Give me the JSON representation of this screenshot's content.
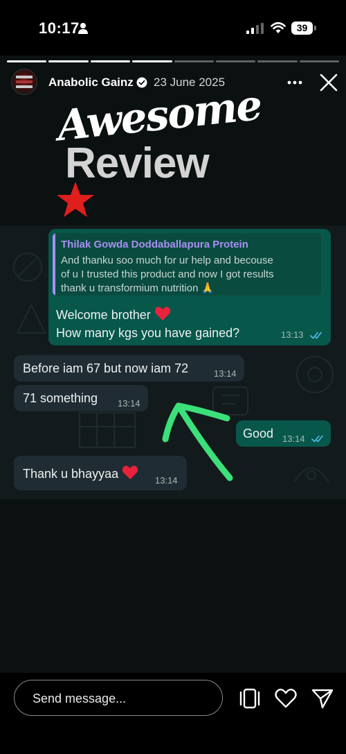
{
  "status_bar": {
    "time": "10:17",
    "battery": "39"
  },
  "story": {
    "username": "Anabolic Gainz",
    "date": "23 June 2025",
    "progress_segments": 8,
    "progress_done": 4
  },
  "title": {
    "line1": "Awesome",
    "line2": "Review"
  },
  "chat": {
    "quote": {
      "name": "Thilak Gowda Doddaballapura Protein",
      "line1": "And thanku soo much for ur help and becouse",
      "line2": "of u I trusted this product and now I got results",
      "line3": "thank u transformium nutrition 🙏"
    },
    "reply_line1": "Welcome  brother",
    "reply_line2": "How many kgs you have gained?",
    "reply_time": "13:13",
    "in1_text": "Before iam 67 but now iam 72",
    "in1_time": "13:14",
    "in2_text": "71 something",
    "in2_time": "13:14",
    "out2_text": "Good",
    "out2_time": "13:14",
    "in3_text": "Thank u bhayyaa",
    "in3_time": "13:14"
  },
  "footer": {
    "message_placeholder": "Send message..."
  },
  "colors": {
    "outgoing_bubble": "#07574b",
    "incoming_bubble": "#1f2c33",
    "arrow": "#3ce07a",
    "star": "#e01e1e"
  }
}
